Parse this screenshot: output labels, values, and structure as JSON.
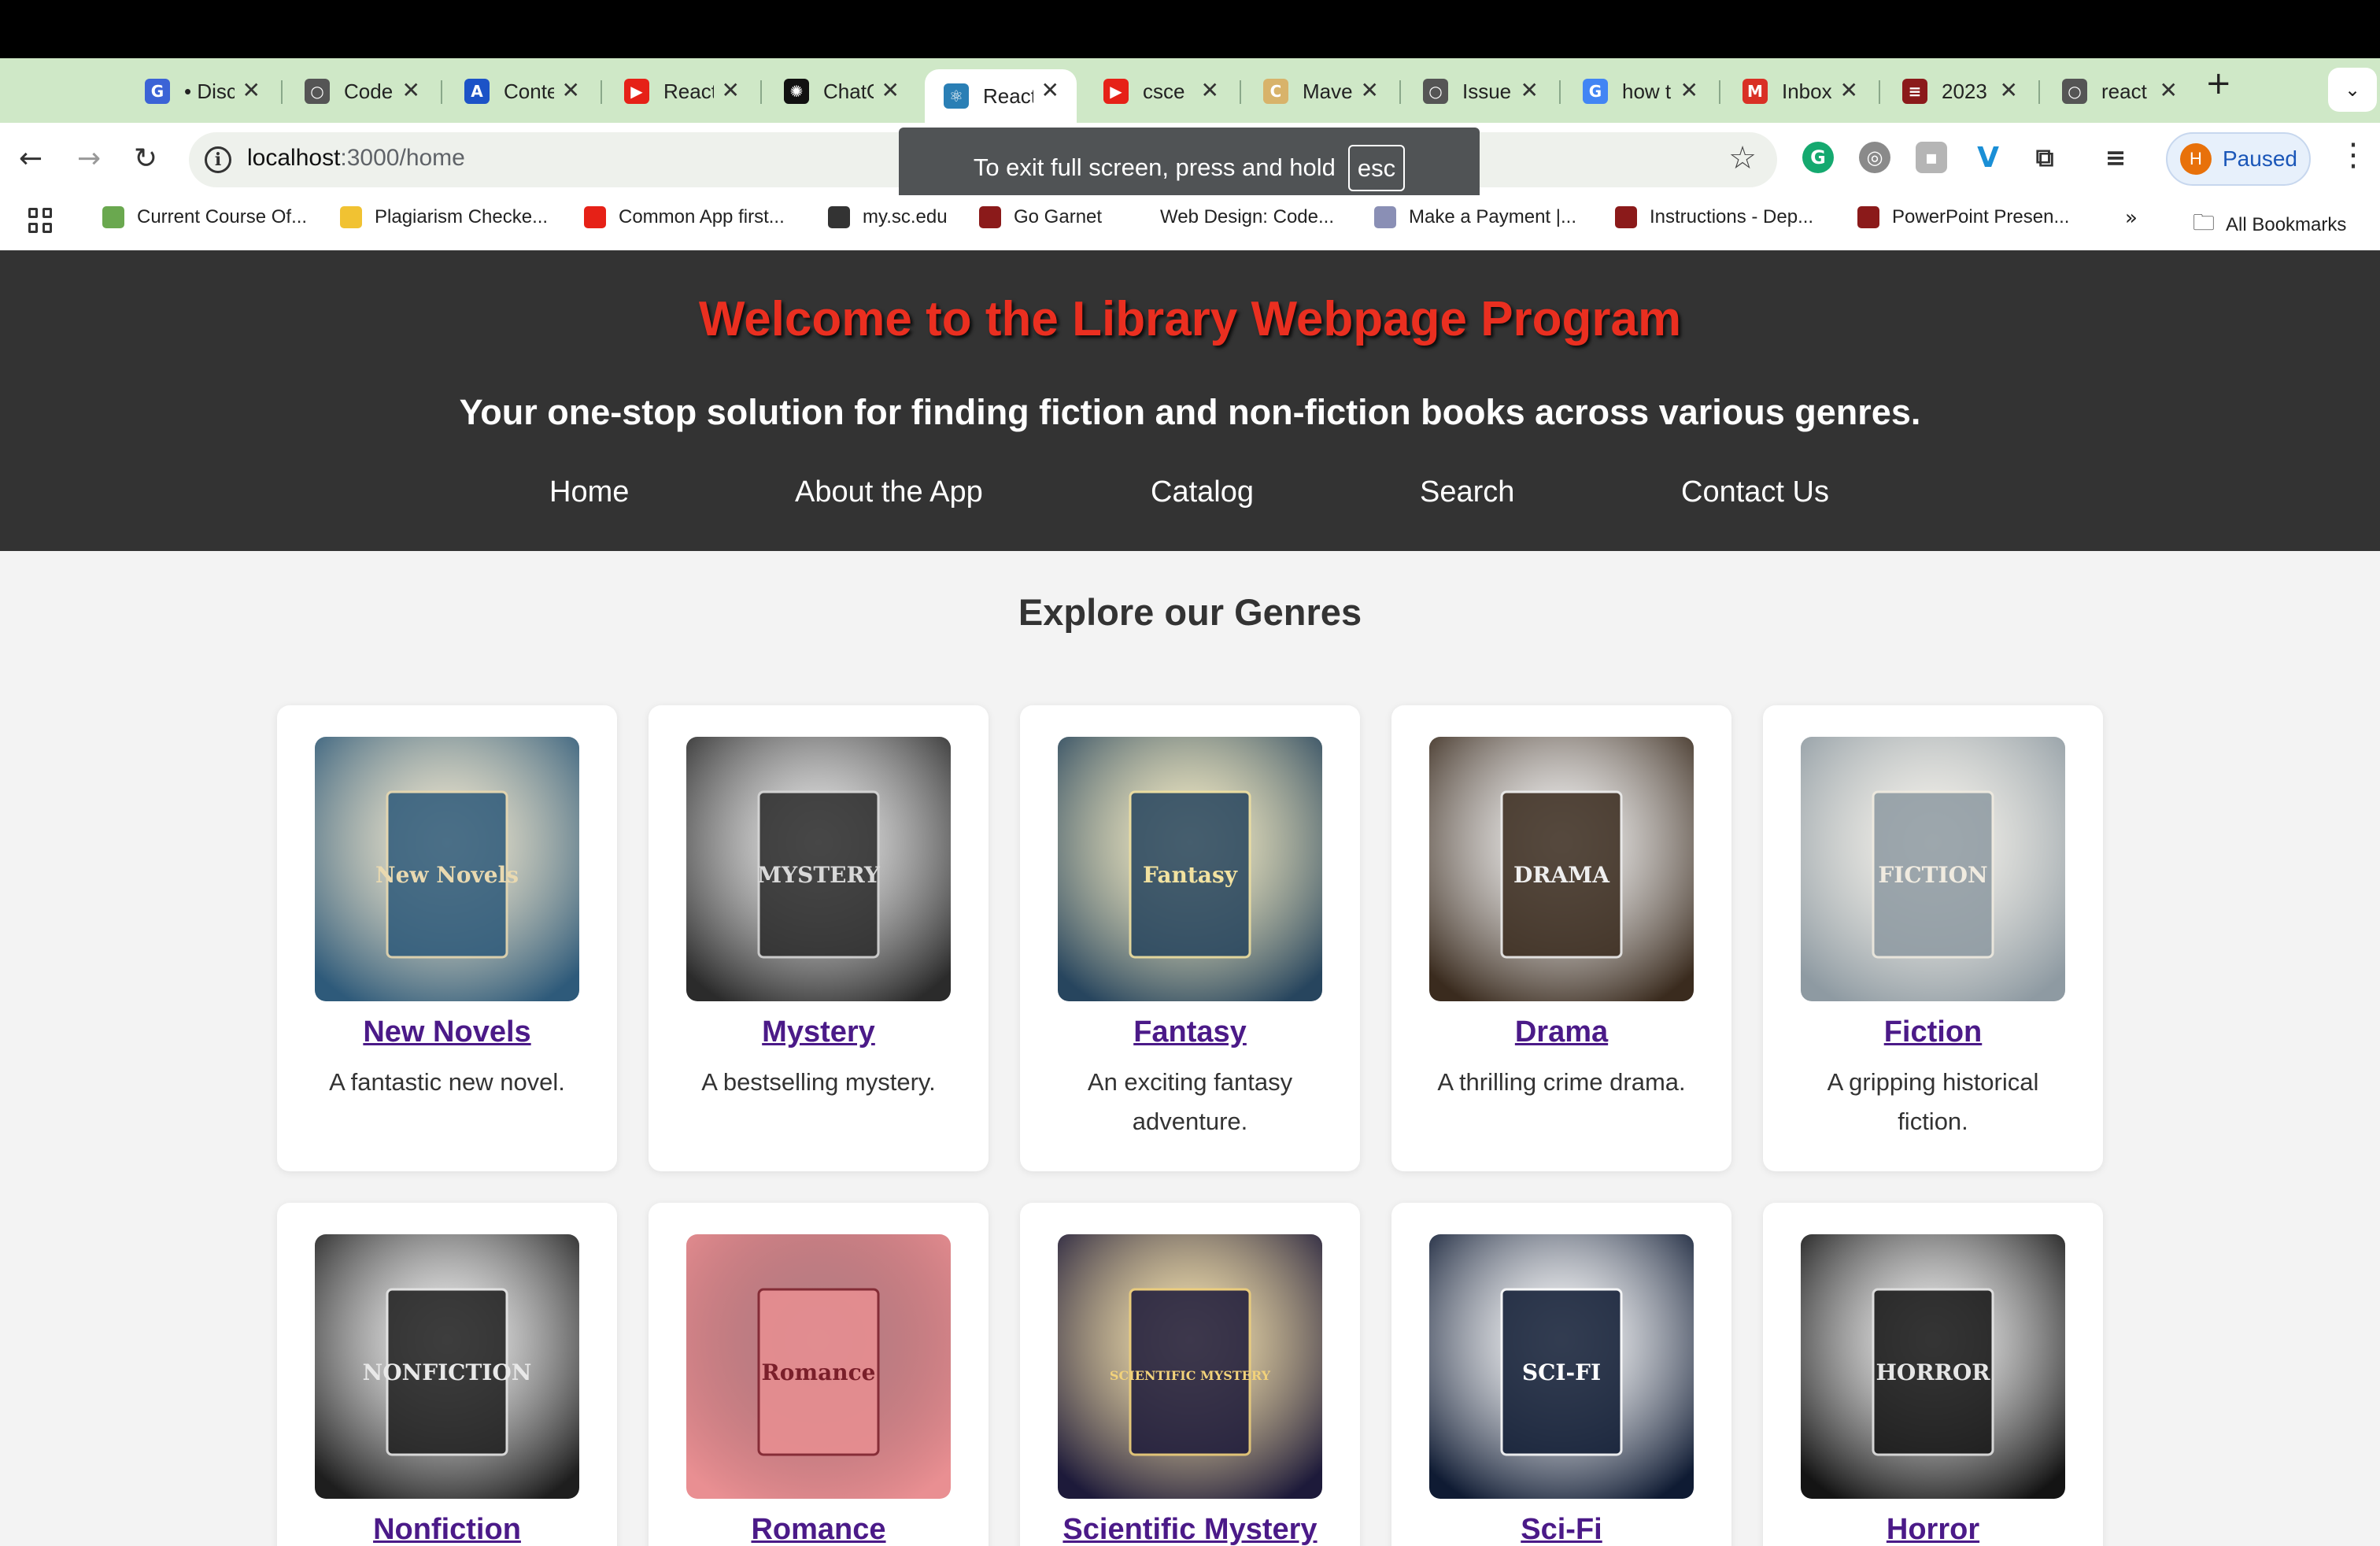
{
  "tabs": [
    {
      "label": "• Disc",
      "icon": "discord-google-icon",
      "color": "#3b63d6",
      "glyph": "G"
    },
    {
      "label": "Code",
      "icon": "github-icon",
      "color": "#555555",
      "glyph": "○"
    },
    {
      "label": "Conte",
      "icon": "content-app-icon",
      "color": "#1c53c7",
      "glyph": "A"
    },
    {
      "label": "React",
      "icon": "youtube-icon",
      "color": "#e62117",
      "glyph": "▶"
    },
    {
      "label": "ChatG",
      "icon": "chatgpt-icon",
      "color": "#111111",
      "glyph": "✺"
    },
    {
      "label": "React",
      "icon": "react-icon",
      "color": "#2a7fb5",
      "glyph": "⚛"
    },
    {
      "label": "csce",
      "icon": "youtube-icon",
      "color": "#e62117",
      "glyph": "▶"
    },
    {
      "label": "Mave",
      "icon": "maven-icon",
      "color": "#d8b36a",
      "glyph": "C"
    },
    {
      "label": "Issue",
      "icon": "github-icon",
      "color": "#555555",
      "glyph": "○"
    },
    {
      "label": "how t",
      "icon": "google-icon",
      "color": "#4285f4",
      "glyph": "G"
    },
    {
      "label": "Inbox",
      "icon": "gmail-icon",
      "color": "#d93025",
      "glyph": "M"
    },
    {
      "label": "2023",
      "icon": "university-icon",
      "color": "#8b1a1a",
      "glyph": "≡"
    },
    {
      "label": "react",
      "icon": "github-icon",
      "color": "#555555",
      "glyph": "○"
    }
  ],
  "browser": {
    "url_host": "localhost",
    "url_rest": ":3000/home",
    "profile_initial": "H",
    "profile_label": "Paused",
    "fullscreen_hint": "To exit full screen, press and hold",
    "fullscreen_key": "esc",
    "new_tab": "+",
    "tab_menu": "⌄",
    "more_bookmarks": "»",
    "all_bookmarks": "All Bookmarks"
  },
  "bookmarks": [
    {
      "label": "Current Course Of...",
      "icon": "course-icon",
      "color": "#6aa84f"
    },
    {
      "label": "Plagiarism Checke...",
      "icon": "chat-bubble-icon",
      "color": "#f1c232"
    },
    {
      "label": "Common App first...",
      "icon": "youtube-icon",
      "color": "#e62117"
    },
    {
      "label": "my.sc.edu",
      "icon": "globe-icon",
      "color": "#333333"
    },
    {
      "label": "Go Garnet",
      "icon": "university-icon",
      "color": "#8b1a1a"
    },
    {
      "label": "Web Design: Code...",
      "icon": "",
      "color": "#ffffff"
    },
    {
      "label": "Make a Payment |...",
      "icon": "payment-icon",
      "color": "#8a8fb5"
    },
    {
      "label": "Instructions - Dep...",
      "icon": "university-icon",
      "color": "#8b1a1a"
    },
    {
      "label": "PowerPoint Presen...",
      "icon": "university-icon",
      "color": "#8b1a1a"
    }
  ],
  "page": {
    "title": "Welcome to the Library Webpage Program",
    "subtitle": "Your one-stop solution for finding fiction and non-fiction books across various genres.",
    "nav": [
      "Home",
      "About the App",
      "Catalog",
      "Search",
      "Contact Us"
    ],
    "section_title": "Explore our Genres"
  },
  "genres": [
    {
      "name": "New Novels",
      "desc": "A fantastic new novel.",
      "cover_text": "New Novels",
      "bg": "#2e5a7a",
      "accent": "#e9d9b0"
    },
    {
      "name": "Mystery",
      "desc": "A bestselling mystery.",
      "cover_text": "MYSTERY",
      "bg": "#2b2b2b",
      "accent": "#d8d8d8"
    },
    {
      "name": "Fantasy",
      "desc": "An exciting fantasy adventure.",
      "cover_text": "Fantasy",
      "bg": "#27455e",
      "accent": "#f2e2a0"
    },
    {
      "name": "Drama",
      "desc": "A thrilling crime drama.",
      "cover_text": "DRAMA",
      "bg": "#3a2b1e",
      "accent": "#efefef"
    },
    {
      "name": "Fiction",
      "desc": "A gripping historical fiction.",
      "cover_text": "FICTION",
      "bg": "#8e9aa2",
      "accent": "#f0ebe0"
    },
    {
      "name": "Nonfiction",
      "desc": "",
      "cover_text": "NONFICTION",
      "bg": "#1e1e1e",
      "accent": "#e8e8e8"
    },
    {
      "name": "Romance",
      "desc": "",
      "cover_text": "Romance",
      "bg": "#e98f92",
      "accent": "#7a1f2a"
    },
    {
      "name": "Scientific Mystery",
      "desc": "",
      "cover_text": "SCIENTIFIC MYSTERY",
      "bg": "#1d1a3a",
      "accent": "#f2d27a"
    },
    {
      "name": "Sci-Fi",
      "desc": "",
      "cover_text": "SCI-FI",
      "bg": "#0f1b33",
      "accent": "#ffffff"
    },
    {
      "name": "Horror",
      "desc": "",
      "cover_text": "HORROR",
      "bg": "#141414",
      "accent": "#e6e6e6"
    }
  ]
}
